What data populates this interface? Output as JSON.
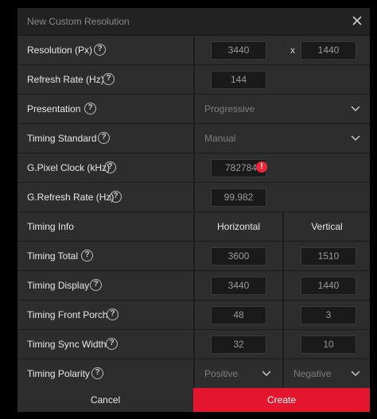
{
  "dialog": {
    "title": "New Custom Resolution"
  },
  "rows": {
    "resolution": {
      "label": "Resolution (Px)",
      "width": "3440",
      "separator": "x",
      "height": "1440"
    },
    "refresh_rate": {
      "label": "Refresh Rate (Hz)",
      "value": "144"
    },
    "presentation": {
      "label": "Presentation",
      "value": "Progressive"
    },
    "timing_standard": {
      "label": "Timing Standard",
      "value": "Manual"
    },
    "pixel_clock": {
      "label": "G.Pixel Clock (kHz)",
      "value": "782784",
      "warning": "!"
    },
    "g_refresh_rate": {
      "label": "G.Refresh Rate (Hz)",
      "value": "99.982"
    },
    "timing_info": {
      "label": "Timing Info",
      "horizontal": "Horizontal",
      "vertical": "Vertical"
    },
    "timing_total": {
      "label": "Timing Total",
      "horizontal": "3600",
      "vertical": "1510"
    },
    "timing_display": {
      "label": "Timing Display",
      "horizontal": "3440",
      "vertical": "1440"
    },
    "timing_front_porch": {
      "label": "Timing Front Porch",
      "horizontal": "48",
      "vertical": "3"
    },
    "timing_sync_width": {
      "label": "Timing Sync Width",
      "horizontal": "32",
      "vertical": "10"
    },
    "timing_polarity": {
      "label": "Timing Polarity",
      "horizontal": "Positive",
      "vertical": "Negative"
    }
  },
  "buttons": {
    "cancel": "Cancel",
    "create": "Create"
  },
  "help_glyph": "?",
  "icons": {
    "close": "close-icon",
    "help": "help-icon",
    "chevron": "chevron-down-icon",
    "warning": "warning-icon"
  },
  "colors": {
    "accent": "#e4162e",
    "warning": "#e8283a"
  }
}
